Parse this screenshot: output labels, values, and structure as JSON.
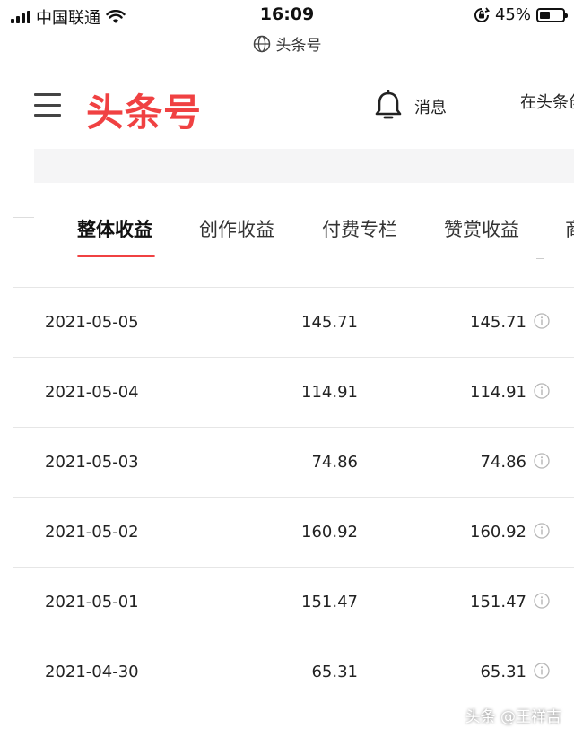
{
  "status_bar": {
    "carrier": "中国联通",
    "time": "16:09",
    "battery_percent": "45%",
    "battery_level": 0.45
  },
  "browser": {
    "site_title": "头条号"
  },
  "header": {
    "logo_text": "头条号",
    "messages_label": "消息",
    "right_link_partial": "在头条创"
  },
  "tabs": [
    {
      "label": "整体收益",
      "active": true
    },
    {
      "label": "创作收益",
      "active": false
    },
    {
      "label": "付费专栏",
      "active": false
    },
    {
      "label": "赞赏收益",
      "active": false
    },
    {
      "label": "商",
      "active": false
    }
  ],
  "rows": [
    {
      "date": "2021-05-05",
      "value1": "145.71",
      "value2": "145.71"
    },
    {
      "date": "2021-05-04",
      "value1": "114.91",
      "value2": "114.91"
    },
    {
      "date": "2021-05-03",
      "value1": "74.86",
      "value2": "74.86"
    },
    {
      "date": "2021-05-02",
      "value1": "160.92",
      "value2": "160.92"
    },
    {
      "date": "2021-05-01",
      "value1": "151.47",
      "value2": "151.47"
    },
    {
      "date": "2021-04-30",
      "value1": "65.31",
      "value2": "65.31"
    }
  ],
  "watermark": "头条 @王祥吉",
  "colors": {
    "brand_red": "#f04142",
    "divider": "#e6e6e6",
    "gray_bar": "#f5f5f6",
    "icon_gray": "#b5b5b5"
  }
}
